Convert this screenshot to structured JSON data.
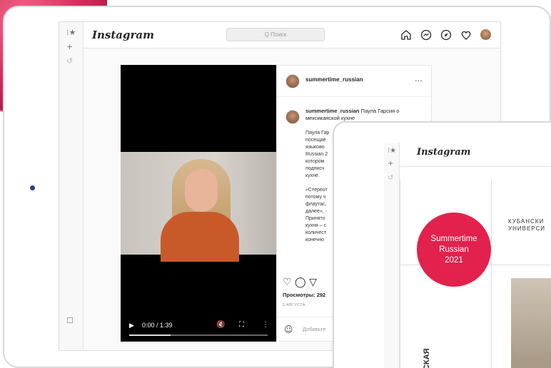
{
  "window1": {
    "logo": "Instagram",
    "search_placeholder": "Q Поиск",
    "nav_icons": [
      "home-icon",
      "messenger-icon",
      "explore-icon",
      "heart-icon",
      "profile-avatar"
    ],
    "post": {
      "username": "summertime_russian",
      "more": "…",
      "caption_user": "summertime_russian",
      "caption_text": "Паула Гарсия о мексиканской кухне",
      "body_lines": [
        "Паула Гар",
        "посещае",
        "языково",
        "Russian 2",
        "котором",
        "подписч",
        "кухне.",
        "",
        "«Стереот",
        "потому ч",
        "флаутас,",
        "далее», -",
        "Принято",
        "кухня – с",
        "количест",
        "конечно"
      ],
      "views": "Просмотры: 292",
      "date": "5 АВГУСТА",
      "add_comment": "Добавьте"
    },
    "video": {
      "time": "0:00 / 1:39",
      "progress": 0.3
    }
  },
  "window2": {
    "logo": "Instagram",
    "circle_lines": [
      "Summertime",
      "Russian",
      "2021"
    ],
    "university_lines": [
      "КУБАНСКИ",
      "УНИВЕРСИ"
    ],
    "vertical_text": "Я СКАЯ"
  },
  "colors": {
    "accent_pink": "#e2214d",
    "dot_blue": "#2a3d8f"
  }
}
